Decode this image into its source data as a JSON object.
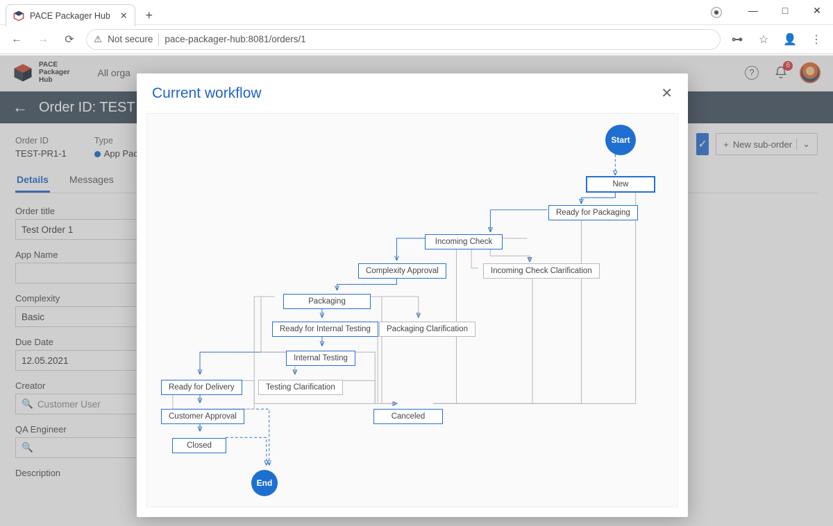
{
  "browser": {
    "tab_title": "PACE Packager Hub",
    "url_prefix": "Not secure",
    "url": "pace-packager-hub:8081/orders/1"
  },
  "window": {
    "min": "—",
    "max": "□",
    "close": "✕"
  },
  "app": {
    "logo_line1": "PACE",
    "logo_line2": "Packager",
    "logo_line3": "Hub",
    "org_label": "All orga",
    "notif_count": "6"
  },
  "order_bar": {
    "title": "Order ID: TEST"
  },
  "summary": {
    "order_id_lbl": "Order ID",
    "order_id": "TEST-PR1-1",
    "type_lbl": "Type",
    "type_val": "App Packa"
  },
  "actions": {
    "new_sub": "New sub-order"
  },
  "tabs": {
    "details": "Details",
    "messages": "Messages"
  },
  "form": {
    "title_lbl": "Order title",
    "title_val": "Test Order 1",
    "app_lbl": "App Name",
    "app_val": "",
    "cx_lbl": "Complexity",
    "cx_val": "Basic",
    "due_lbl": "Due Date",
    "due_val": "12.05.2021",
    "creator_lbl": "Creator",
    "creator_val": "Customer User",
    "qa_lbl": "QA Engineer",
    "qa_val": "",
    "desc_lbl": "Description"
  },
  "modal": {
    "title": "Current workflow"
  },
  "wf": {
    "start": "Start",
    "end": "End",
    "new": "New",
    "ready_pkg": "Ready for Packaging",
    "in_check": "Incoming Check",
    "in_check_clar": "Incoming Check Clarification",
    "cx_appr": "Complexity Approval",
    "pkg": "Packaging",
    "pkg_clar": "Packaging Clarification",
    "rft": "Ready for Internal Testing",
    "it": "Internal Testing",
    "tc": "Testing Clarification",
    "rfd": "Ready for Delivery",
    "ca": "Customer Approval",
    "closed": "Closed",
    "cancel": "Canceled"
  }
}
